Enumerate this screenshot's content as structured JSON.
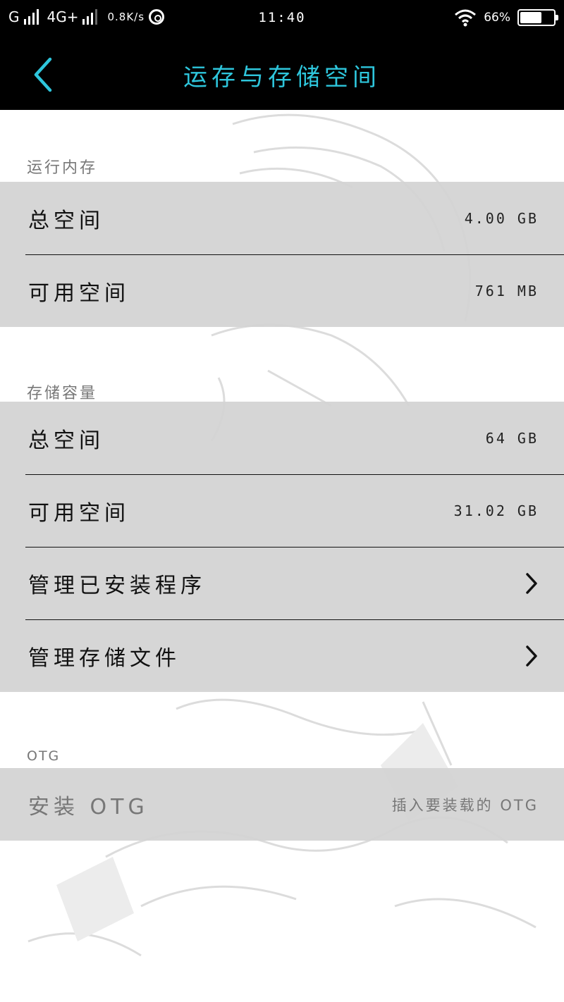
{
  "status_bar": {
    "carrier1": "G",
    "carrier2": "4G+",
    "speed": "0.8K/s",
    "time": "11:40",
    "battery_text": "66%",
    "battery_level": 0.66
  },
  "header": {
    "title": "运存与存储空间",
    "back_icon": "chevron-left-icon"
  },
  "sections": {
    "ram": {
      "label": "运行内存",
      "items": [
        {
          "label": "总空间",
          "value": "4.00 GB"
        },
        {
          "label": "可用空间",
          "value": "761 MB"
        }
      ]
    },
    "storage": {
      "label": "存储容量",
      "items": [
        {
          "label": "总空间",
          "value": "64 GB"
        },
        {
          "label": "可用空间",
          "value": "31.02 GB"
        },
        {
          "label": "管理已安装程序"
        },
        {
          "label": "管理存储文件"
        }
      ]
    },
    "otg": {
      "label": "OTG",
      "items": [
        {
          "label": "安装 OTG",
          "value": "插入要装载的 OTG"
        }
      ]
    }
  },
  "colors": {
    "accent": "#2ec6dc",
    "row_bg": "#d2d2d2",
    "header_bg": "#000000"
  }
}
